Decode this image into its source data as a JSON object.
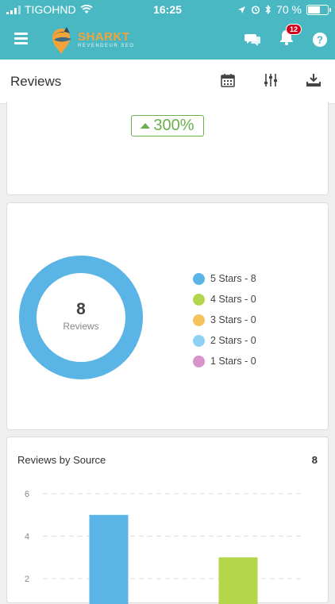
{
  "status_bar": {
    "carrier": "TIGOHND",
    "time": "16:25",
    "battery_percent": 70,
    "battery_label": "70 %"
  },
  "app_bar": {
    "brand_name": "SHARKT",
    "brand_tagline": "REVENDEUR SEO",
    "notification_count": "12",
    "icons": [
      "menu-icon",
      "chat-icon",
      "bell-icon",
      "help-icon"
    ]
  },
  "toolbar": {
    "title": "Reviews",
    "icons": [
      "calendar-icon",
      "filter-icon",
      "download-icon"
    ]
  },
  "growth_card": {
    "growth_value": "300%",
    "trend": "up",
    "color": "#6ab04c"
  },
  "summary_card": {
    "total_reviews": "8",
    "total_label": "Reviews",
    "legend": [
      {
        "label": "5 Stars - 8",
        "color": "#5ab4e5",
        "count": 8
      },
      {
        "label": "4 Stars - 0",
        "color": "#b4d64a",
        "count": 0
      },
      {
        "label": "3 Stars - 0",
        "color": "#f6c25c",
        "count": 0
      },
      {
        "label": "2 Stars - 0",
        "color": "#8fd1f4",
        "count": 0
      },
      {
        "label": "1 Stars - 0",
        "color": "#d892cc",
        "count": 0
      }
    ]
  },
  "source_card": {
    "title": "Reviews by Source",
    "total": "8"
  },
  "chart_data": {
    "type": "bar",
    "title": "Reviews by Source",
    "categories": [
      "",
      ""
    ],
    "values": [
      5,
      3
    ],
    "colors": [
      "#5ab4e5",
      "#b4d64a"
    ],
    "yticks": [
      2,
      4,
      6
    ],
    "ylim": [
      0,
      7
    ],
    "grid": true,
    "xlabel": "",
    "ylabel": ""
  },
  "colors": {
    "header_bg": "#4ab8c2",
    "accent": "#f2a43a"
  }
}
